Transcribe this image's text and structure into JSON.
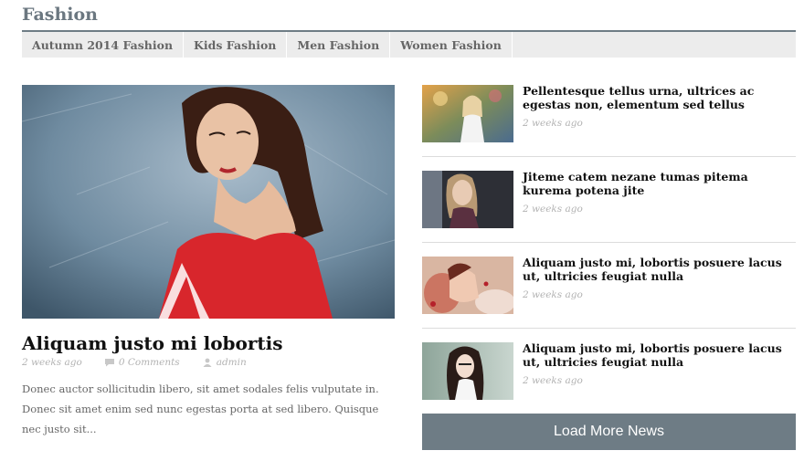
{
  "section": {
    "title": "Fashion"
  },
  "tabs": [
    {
      "label": "Autumn 2014 Fashion"
    },
    {
      "label": "Kids Fashion"
    },
    {
      "label": "Men Fashion"
    },
    {
      "label": "Women Fashion"
    }
  ],
  "featured": {
    "title": "Aliquam justo mi lobortis",
    "date": "2 weeks ago",
    "comments": "0 Comments",
    "author": "admin",
    "excerpt": "Donec auctor sollicitudin libero, sit amet sodales felis vulputate in. Donec sit amet enim sed nunc egestas porta at sed libero. Quisque nec justo sit..."
  },
  "news": [
    {
      "title": "Pellentesque tellus urna, ultrices ac egestas non, elementum sed tellus",
      "date": "2 weeks ago"
    },
    {
      "title": "Jiteme catem nezane tumas pitema kurema potena jite",
      "date": "2 weeks ago"
    },
    {
      "title": "Aliquam justo mi, lobortis posuere lacus ut, ultricies feugiat nulla",
      "date": "2 weeks ago"
    },
    {
      "title": "Aliquam justo mi, lobortis posuere lacus ut, ultricies feugiat nulla",
      "date": "2 weeks ago"
    }
  ],
  "load_more": {
    "label": "Load More News"
  },
  "icons": {
    "comments": "comment-bubble-icon",
    "author": "user-icon"
  },
  "colors": {
    "accent": "#6e7c85",
    "tab_bg": "#ececec",
    "meta": "#b3b3b3"
  }
}
